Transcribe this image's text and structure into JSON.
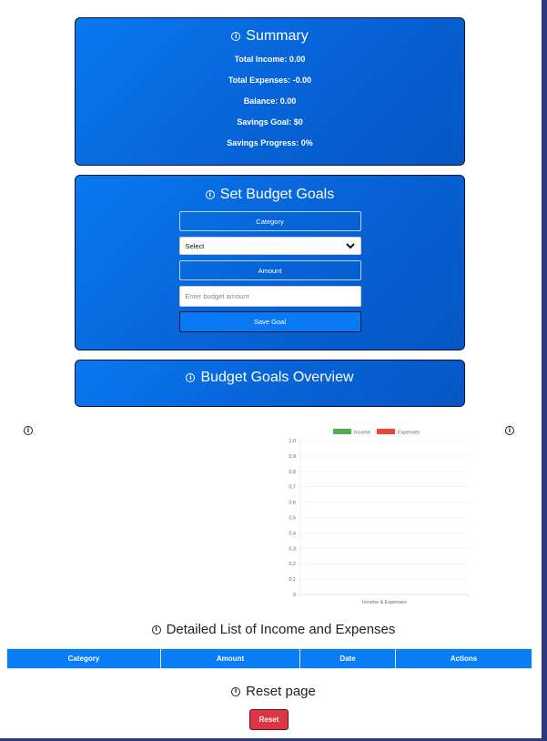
{
  "summary": {
    "title": "Summary",
    "total_income": "Total Income: 0.00",
    "total_expenses": "Total Expenses: -0.00",
    "balance": "Balance: 0.00",
    "savings_goal": "Savings Goal: $0",
    "savings_progress": "Savings Progress: 0%"
  },
  "budget": {
    "title": "Set Budget Goals",
    "category_label": "Category",
    "category_select_value": "Select",
    "amount_label": "Amount",
    "amount_placeholder": "Enter budget amount",
    "save_label": "Save Goal"
  },
  "overview": {
    "title": "Budget Goals Overview"
  },
  "chart_data": {
    "type": "bar",
    "categories": [
      "Income & Expenses"
    ],
    "series": [
      {
        "name": "Income",
        "values": [
          0
        ],
        "color": "#4caf50"
      },
      {
        "name": "Expenses",
        "values": [
          0
        ],
        "color": "#f44336"
      }
    ],
    "ylim": [
      0,
      1
    ],
    "y_ticks": [
      "0",
      "0,1",
      "0,2",
      "0,3",
      "0,4",
      "0,5",
      "0,6",
      "0,7",
      "0,8",
      "0,9",
      "1,0"
    ],
    "legend": "top",
    "grid": true
  },
  "list": {
    "title": "Detailed List of Income and Expenses",
    "columns": [
      "Category",
      "Amount",
      "Date",
      "Actions"
    ]
  },
  "reset": {
    "title": "Reset page",
    "button_label": "Reset",
    "color": "#dc3545"
  },
  "icons": {
    "info": "info-circle-icon",
    "dropdown": "chevron-down-icon"
  }
}
